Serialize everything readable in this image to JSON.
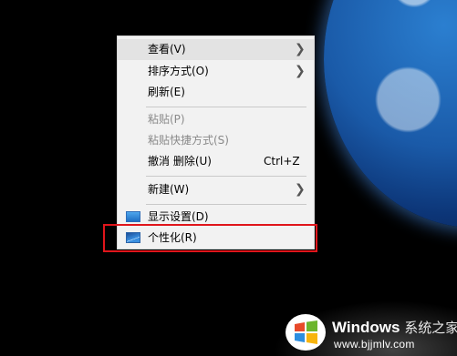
{
  "menu": {
    "items": [
      {
        "label": "查看(V)",
        "submenu": true
      },
      {
        "label": "排序方式(O)",
        "submenu": true
      },
      {
        "label": "刷新(E)"
      },
      {
        "label": "粘贴(P)",
        "disabled": true
      },
      {
        "label": "粘贴快捷方式(S)",
        "disabled": true
      },
      {
        "label": "撤消 删除(U)",
        "shortcut": "Ctrl+Z"
      },
      {
        "label": "新建(W)",
        "submenu": true
      },
      {
        "label": "显示设置(D)",
        "icon": "display-settings-icon"
      },
      {
        "label": "个性化(R)",
        "icon": "personalize-icon",
        "highlighted": true
      }
    ]
  },
  "watermark": {
    "brand": "Windows",
    "cn": "系统之家",
    "url": "www.bjjmlv.com"
  },
  "colors": {
    "highlight_box": "#e0151b",
    "menu_bg": "#f2f2f2"
  }
}
